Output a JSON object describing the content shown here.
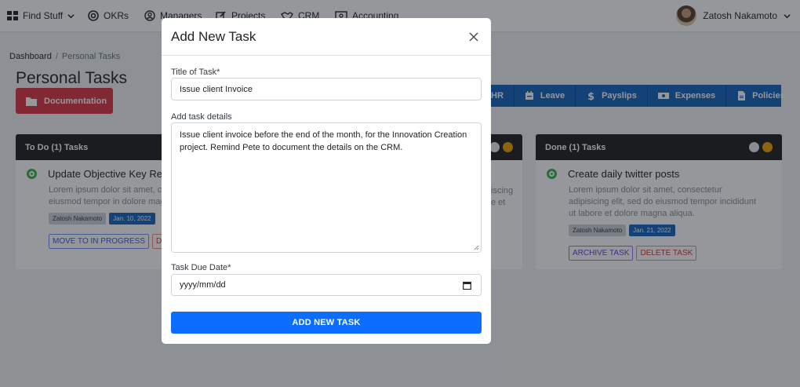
{
  "nav": {
    "menu_label": "Find Stuff",
    "items": [
      {
        "label": "OKRs",
        "icon": "target-icon"
      },
      {
        "label": "Managers",
        "icon": "user-circle-icon"
      },
      {
        "label": "Projects",
        "icon": "edit-icon"
      },
      {
        "label": "CRM",
        "icon": "handshake-icon"
      },
      {
        "label": "Accounting",
        "icon": "money-icon"
      }
    ],
    "user_name": "Zatosh Nakamoto"
  },
  "breadcrumb": {
    "root": "Dashboard",
    "separator": "/",
    "current": "Personal Tasks"
  },
  "page": {
    "title": "Personal Tasks",
    "documentation_label": "Documentation"
  },
  "hr_menu": [
    {
      "label": "HR"
    },
    {
      "label": "Leave",
      "icon": "calendar-icon"
    },
    {
      "label": "Payslips",
      "icon": "dollar-icon"
    },
    {
      "label": "Expenses",
      "icon": "money-icon"
    },
    {
      "label": "Policies",
      "icon": "file-icon"
    }
  ],
  "columns": [
    {
      "title": "To Do (1) Tasks",
      "task": {
        "title": "Update Objective Key Res",
        "description": "Lorem ipsum dolor sit amet, co elit, sed do eiusmod tempor in dolore magna aliqua.",
        "assignee": "Zatosh Nakamoto",
        "date": "Jan. 10, 2022",
        "actions": [
          "MOVE TO IN PROGRESS",
          "D"
        ]
      }
    },
    {
      "title": "Done (1) Tasks",
      "task": {
        "title": "Create daily twitter posts",
        "description": "Lorem ipsum dolor sit amet, consectetur adipisicing elit, sed do eiusmod tempor incididunt ut labore et dolore magna aliqua.",
        "assignee": "Zatosh Nakamoto",
        "date": "Jan. 21, 2022",
        "actions": [
          "ARCHIVE TASK",
          "DELETE TASK"
        ]
      }
    }
  ],
  "middle_fragments": [
    "iscing",
    "e et"
  ],
  "modal": {
    "title": "Add New Task",
    "title_label": "Title of Task*",
    "title_value": "Issue client Invoice",
    "details_label": "Add task details",
    "details_value": "Issue client invoice before the end of the month, for the Innovation Creation project. Remind Pete to document the details on the CRM.",
    "due_label": "Task Due Date*",
    "due_value": "yyyy/mm/dd",
    "submit_label": "ADD NEW TASK"
  },
  "colors": {
    "primary": "#0d6efd",
    "danger": "#dc3545",
    "hr_bar": "#1565c0",
    "column_header": "#1f1f1f",
    "success": "#37b24d"
  }
}
